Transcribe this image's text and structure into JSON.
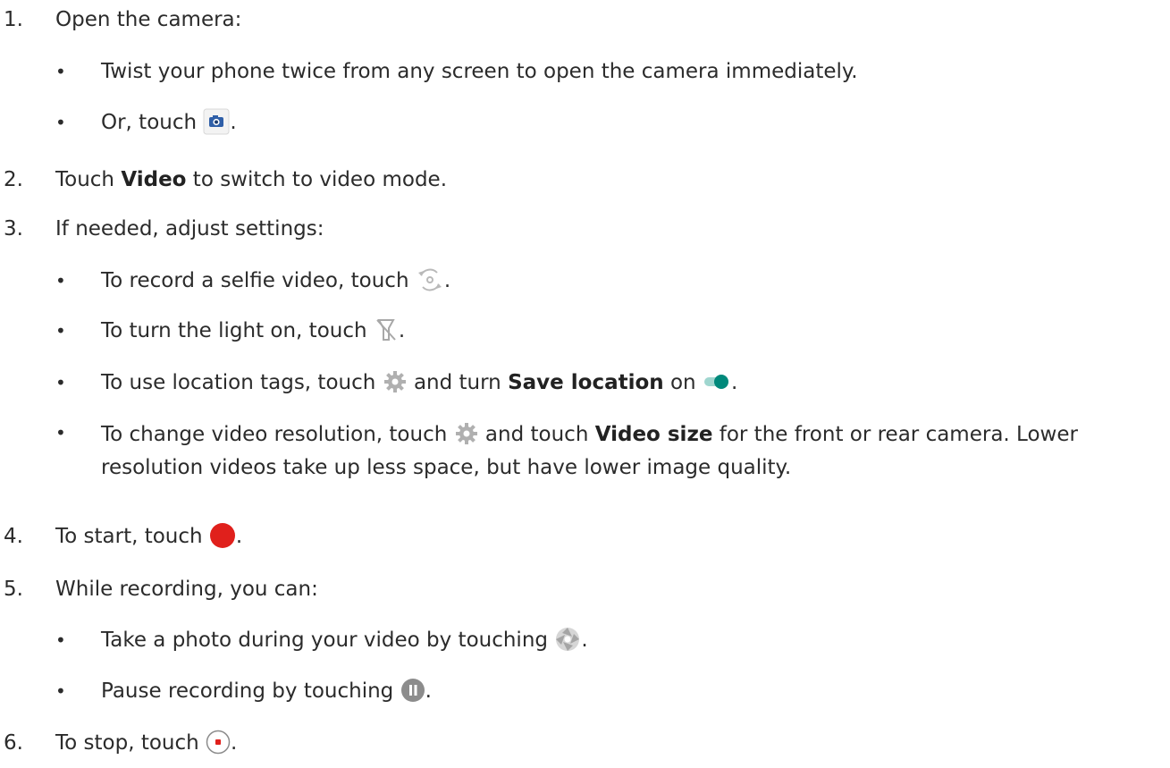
{
  "steps": [
    {
      "num": "1.",
      "text": "Open the camera:"
    },
    {
      "num": "2.",
      "text_before": "Touch ",
      "bold": "Video",
      "text_after": " to switch to video mode."
    },
    {
      "num": "3.",
      "text": "If needed, adjust settings:"
    },
    {
      "num": "4.",
      "text_before": "To start, touch ",
      "text_after": "."
    },
    {
      "num": "5.",
      "text": "While recording, you can:"
    },
    {
      "num": "6.",
      "text_before": "To stop, touch ",
      "text_after": "."
    }
  ],
  "step1_bullets": [
    {
      "text": "Twist your phone twice from any screen to open the camera immediately."
    },
    {
      "text_before": "Or, touch ",
      "text_after": "."
    }
  ],
  "step3_bullets": [
    {
      "text_before": "To record a selfie video, touch ",
      "text_after": "."
    },
    {
      "text_before": "To turn the light on, touch ",
      "text_after": "."
    },
    {
      "text_before": "To use location tags, touch ",
      "text_mid": " and turn ",
      "bold": "Save location",
      "text_mid2": " on ",
      "text_after": "."
    },
    {
      "text_before": "To change video resolution, touch ",
      "text_mid": " and touch ",
      "bold": "Video size",
      "text_after": " for the front or rear camera. Lower resolution videos take up less space, but have lower image quality."
    }
  ],
  "step5_bullets": [
    {
      "text_before": "Take a photo during your video by touching ",
      "text_after": "."
    },
    {
      "text_before": "Pause recording by touching ",
      "text_after": "."
    }
  ],
  "bullet_char": "•",
  "icons": [
    "camera-app-icon",
    "switch-camera-icon",
    "flash-off-icon",
    "settings-gear-icon",
    "toggle-on-icon",
    "record-button-icon",
    "shutter-icon",
    "pause-button-icon",
    "stop-button-icon"
  ],
  "colors": {
    "text": "#2b2b2b",
    "record_red": "#e0201c",
    "toggle_teal": "#00897b",
    "icon_gray": "#9e9e9e"
  }
}
